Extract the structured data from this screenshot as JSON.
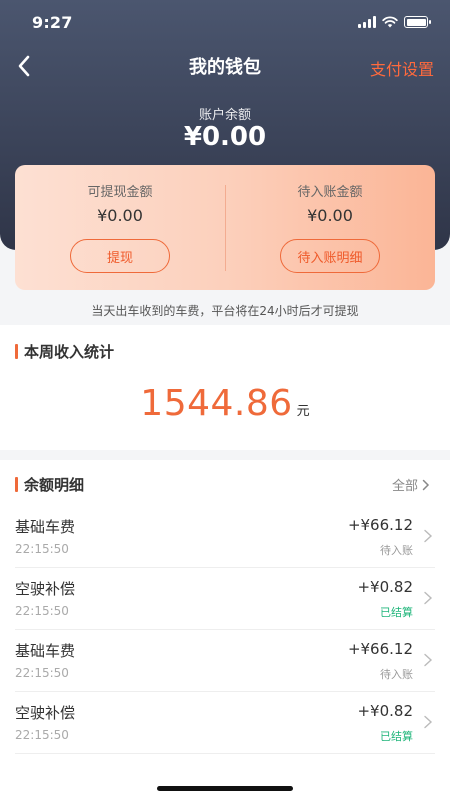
{
  "status_bar": {
    "time": "9:27"
  },
  "nav": {
    "title": "我的钱包",
    "right_action": "支付设置"
  },
  "balance": {
    "label": "账户余额",
    "value": "¥0.00"
  },
  "card": {
    "withdrawable": {
      "label": "可提现金额",
      "amount": "¥0.00",
      "button": "提现"
    },
    "pending": {
      "label": "待入账金额",
      "amount": "¥0.00",
      "button": "待入账明细"
    }
  },
  "notice": "当天出车收到的车费，平台将在24小时后才可提现",
  "weekly": {
    "title": "本周收入统计",
    "value": "1544.86",
    "unit": "元"
  },
  "detail": {
    "title": "余额明细",
    "all_label": "全部",
    "items": [
      {
        "name": "基础车费",
        "time": "22:15:50",
        "amount": "+¥66.12",
        "status": "待入账",
        "status_type": "pending"
      },
      {
        "name": "空驶补偿",
        "time": "22:15:50",
        "amount": "+¥0.82",
        "status": "已结算",
        "status_type": "settled"
      },
      {
        "name": "基础车费",
        "time": "22:15:50",
        "amount": "+¥66.12",
        "status": "待入账",
        "status_type": "pending"
      },
      {
        "name": "空驶补偿",
        "time": "22:15:50",
        "amount": "+¥0.82",
        "status": "已结算",
        "status_type": "settled"
      }
    ]
  },
  "colors": {
    "accent": "#ef6a3a",
    "settled": "#1fb57a",
    "header_dark": "#2f3548"
  }
}
